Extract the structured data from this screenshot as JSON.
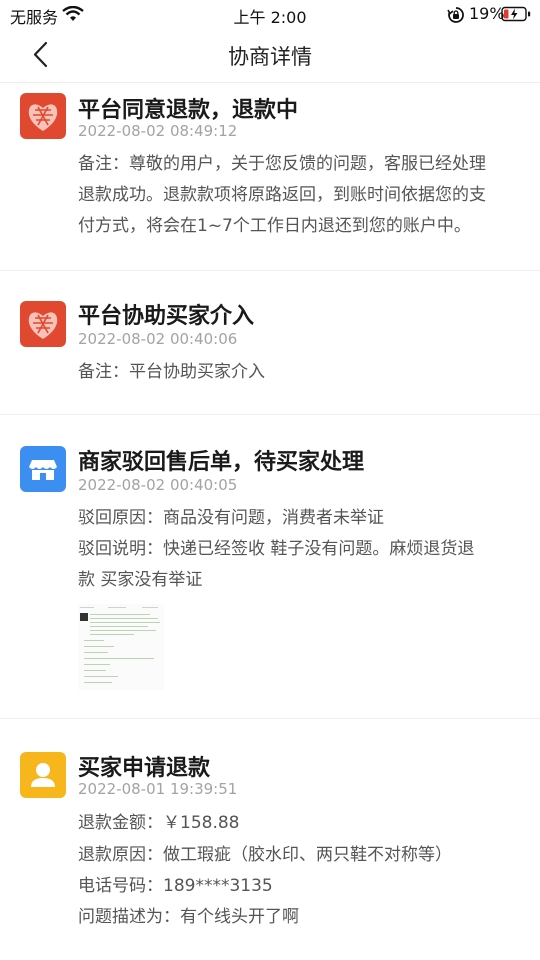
{
  "status_bar": {
    "carrier": "无服务",
    "time": "上午 2:00",
    "battery": "19%",
    "icons": [
      "wifi-icon",
      "orientation-lock-icon",
      "battery-charging-icon"
    ]
  },
  "header": {
    "back_icon": "chevron-left-icon",
    "title": "协商详情"
  },
  "events": [
    {
      "icon": "pinduoduo-logo-icon",
      "title": "平台同意退款，退款中",
      "date": "2022-08-02 08:49:12",
      "lines": [
        "备注：尊敬的用户，关于您反馈的问题，客服已经处理",
        "退款成功。退款款项将原路返回，到账时间依据您的支",
        "付方式，将会在1~7个工作日内退还到您的账户中。"
      ]
    },
    {
      "icon": "pinduoduo-logo-icon",
      "title": "平台协助买家介入",
      "date": "2022-08-02 00:40:06",
      "lines": [
        "备注：平台协助买家介入"
      ]
    },
    {
      "icon": "store-icon",
      "title": "商家驳回售后单，待买家处理",
      "date": "2022-08-02 00:40:05",
      "lines": [
        "驳回原因：商品没有问题，消费者未举证",
        "驳回说明：快递已经签收 鞋子没有问题。麻烦退货退",
        "款 买家没有举证"
      ]
    },
    {
      "icon": "person-icon",
      "title": "买家申请退款",
      "date": "2022-08-01 19:39:51",
      "lines": [
        "退款金额：￥158.88",
        "退款原因：做工瑕疵（胶水印、两只鞋不对称等）",
        "电话号码：189****3135",
        "问题描述为：有个线头开了啊"
      ]
    }
  ],
  "colors": {
    "pinduoduo_red": "#e0482f",
    "store_blue": "#3c8ef0",
    "buyer_yellow": "#f6b61c"
  }
}
